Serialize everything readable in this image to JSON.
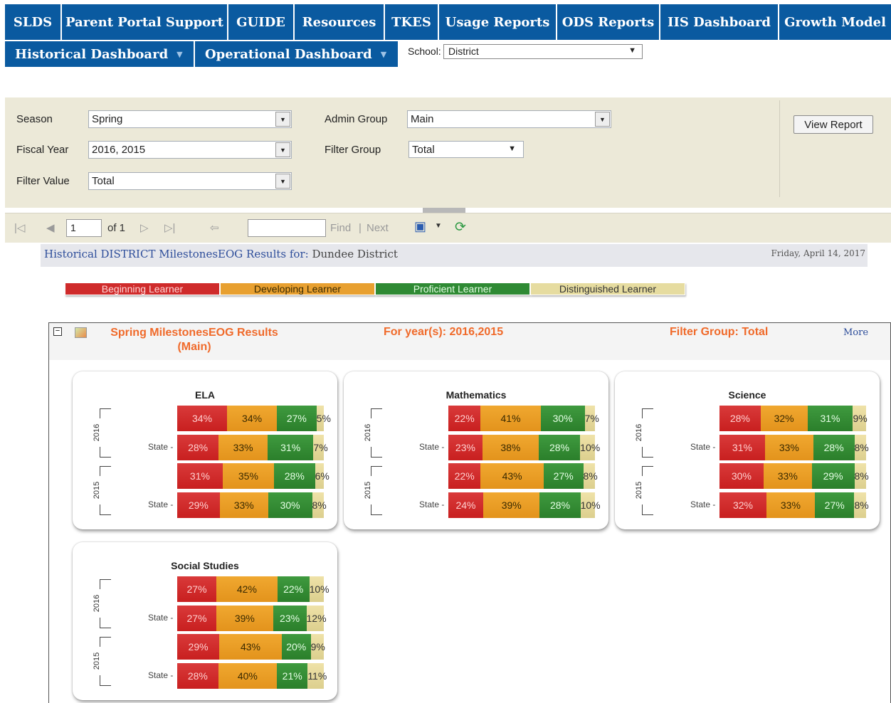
{
  "nav": {
    "top": [
      "SLDS",
      "Parent Portal Support",
      "GUIDE",
      "Resources",
      "TKES",
      "Usage Reports",
      "ODS Reports",
      "IIS Dashboard",
      "Growth Model"
    ],
    "secondary": [
      "Historical Dashboard",
      "Operational Dashboard"
    ],
    "school_label": "School:",
    "school_value": "District"
  },
  "params": {
    "season_label": "Season",
    "season_value": "Spring",
    "fiscal_year_label": "Fiscal Year",
    "fiscal_year_value": "2016, 2015",
    "filter_value_label": "Filter Value",
    "filter_value_value": "Total",
    "admin_group_label": "Admin Group",
    "admin_group_value": "Main",
    "filter_group_label": "Filter Group",
    "filter_group_value": "Total",
    "view_report": "View Report"
  },
  "toolbar": {
    "page": "1",
    "of": "of 1",
    "find": "Find",
    "sep": "|",
    "next": "Next"
  },
  "header": {
    "title": "Historical  DISTRICT MilestonesEOG Results for:",
    "district": "Dundee District",
    "date": "Friday, April 14, 2017"
  },
  "legend": [
    {
      "label": "Beginning Learner",
      "color": "#cf2b2b"
    },
    {
      "label": "Developing Learner",
      "color": "#e8a030"
    },
    {
      "label": "Proficient Learner",
      "color": "#2f8a34"
    },
    {
      "label": "Distinguished Learner",
      "color": "#e6dca0"
    }
  ],
  "results": {
    "title_line1": "Spring MilestonesEOG Results",
    "title_line2": "(Main)",
    "years": "For year(s): 2016,2015",
    "filter_group": "Filter Group: Total",
    "more": "More"
  },
  "state_label": "State",
  "chart_data": [
    {
      "type": "bar",
      "title": "ELA",
      "years": [
        "2016",
        "2015"
      ],
      "rows": [
        {
          "year": "2016",
          "label": "",
          "values": [
            34,
            34,
            27,
            5
          ]
        },
        {
          "year": "2016",
          "label": "State",
          "values": [
            28,
            33,
            31,
            7
          ]
        },
        {
          "year": "2015",
          "label": "",
          "values": [
            31,
            35,
            28,
            6
          ]
        },
        {
          "year": "2015",
          "label": "State",
          "values": [
            29,
            33,
            30,
            8
          ]
        }
      ]
    },
    {
      "type": "bar",
      "title": "Mathematics",
      "years": [
        "2016",
        "2015"
      ],
      "rows": [
        {
          "year": "2016",
          "label": "",
          "values": [
            22,
            41,
            30,
            7
          ]
        },
        {
          "year": "2016",
          "label": "State",
          "values": [
            23,
            38,
            28,
            10
          ]
        },
        {
          "year": "2015",
          "label": "",
          "values": [
            22,
            43,
            27,
            8
          ]
        },
        {
          "year": "2015",
          "label": "State",
          "values": [
            24,
            39,
            28,
            10
          ]
        }
      ]
    },
    {
      "type": "bar",
      "title": "Science",
      "years": [
        "2016",
        "2015"
      ],
      "rows": [
        {
          "year": "2016",
          "label": "",
          "values": [
            28,
            32,
            31,
            9
          ]
        },
        {
          "year": "2016",
          "label": "State",
          "values": [
            31,
            33,
            28,
            8
          ]
        },
        {
          "year": "2015",
          "label": "",
          "values": [
            30,
            33,
            29,
            8
          ]
        },
        {
          "year": "2015",
          "label": "State",
          "values": [
            32,
            33,
            27,
            8
          ]
        }
      ]
    },
    {
      "type": "bar",
      "title": "Social Studies",
      "years": [
        "2016",
        "2015"
      ],
      "rows": [
        {
          "year": "2016",
          "label": "",
          "values": [
            27,
            42,
            22,
            10
          ]
        },
        {
          "year": "2016",
          "label": "State",
          "values": [
            27,
            39,
            23,
            12
          ]
        },
        {
          "year": "2015",
          "label": "",
          "values": [
            29,
            43,
            20,
            9
          ]
        },
        {
          "year": "2015",
          "label": "State",
          "values": [
            28,
            40,
            21,
            11
          ]
        }
      ]
    }
  ]
}
